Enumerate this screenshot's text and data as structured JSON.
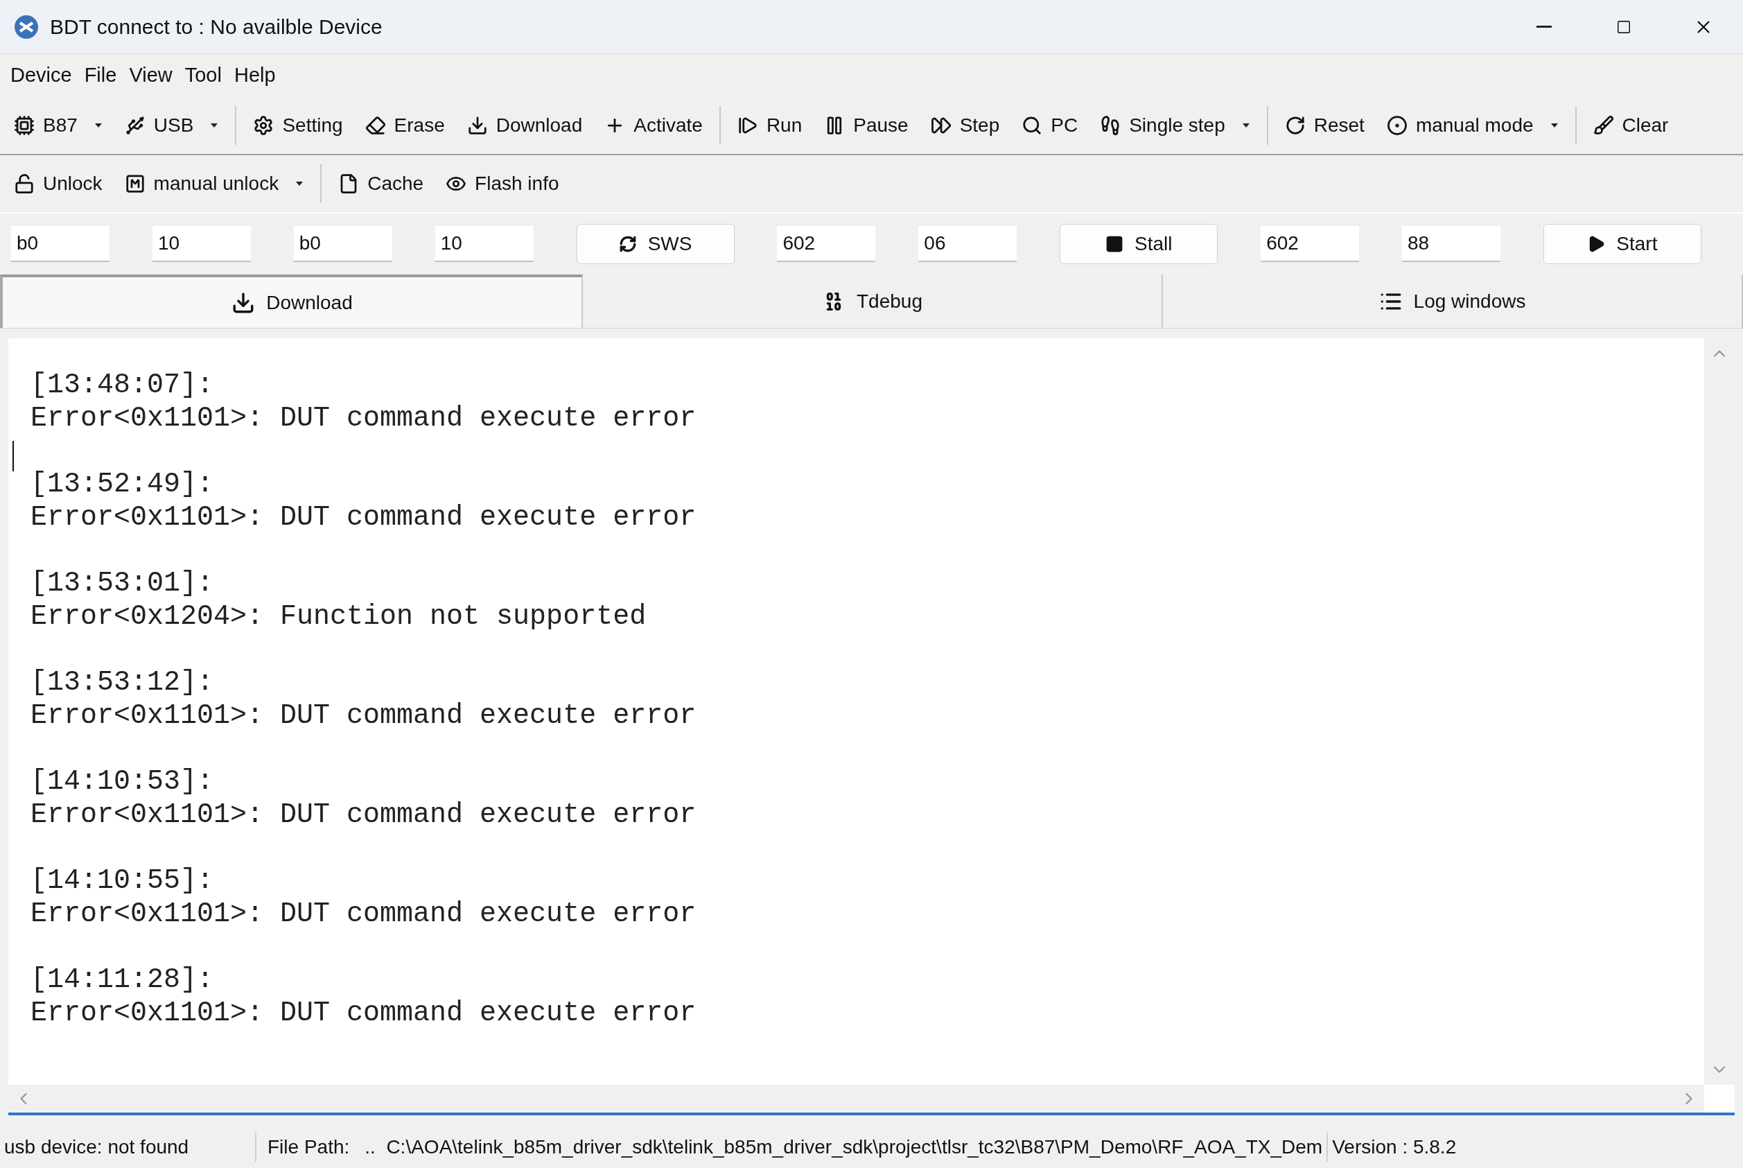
{
  "window": {
    "title": "BDT connect to : No availble Device"
  },
  "menu": [
    "Device",
    "File",
    "View",
    "Tool",
    "Help"
  ],
  "toolbar_1": [
    [
      {
        "label": "B87",
        "kind": "dropdown"
      },
      {
        "label": "USB",
        "kind": "dropdown"
      }
    ],
    [
      {
        "label": "Setting",
        "kind": "button"
      },
      {
        "label": "Erase",
        "kind": "button"
      },
      {
        "label": "Download",
        "kind": "button"
      },
      {
        "label": "Activate",
        "kind": "button"
      }
    ],
    [
      {
        "label": "Run",
        "kind": "button"
      },
      {
        "label": "Pause",
        "kind": "button"
      },
      {
        "label": "Step",
        "kind": "button"
      },
      {
        "label": "PC",
        "kind": "button"
      },
      {
        "label": "Single step",
        "kind": "dropdown"
      }
    ],
    [
      {
        "label": "Reset",
        "kind": "button"
      },
      {
        "label": "manual mode",
        "kind": "dropdown"
      }
    ],
    [
      {
        "label": "Clear",
        "kind": "button"
      }
    ]
  ],
  "toolbar_2": [
    [
      {
        "label": "Unlock",
        "kind": "button"
      },
      {
        "label": "manual unlock",
        "kind": "dropdown"
      }
    ],
    [
      {
        "label": "Cache",
        "kind": "button"
      },
      {
        "label": "Flash info",
        "kind": "button"
      }
    ]
  ],
  "command_row": [
    {
      "kind": "field",
      "value": "b0"
    },
    {
      "kind": "field",
      "value": "10"
    },
    {
      "kind": "field",
      "value": "b0"
    },
    {
      "kind": "field",
      "value": "10"
    },
    {
      "kind": "button",
      "label": "SWS"
    },
    {
      "kind": "field",
      "value": "602"
    },
    {
      "kind": "field",
      "value": "06"
    },
    {
      "kind": "button",
      "label": "Stall"
    },
    {
      "kind": "field",
      "value": "602"
    },
    {
      "kind": "field",
      "value": "88"
    },
    {
      "kind": "button",
      "label": "Start"
    }
  ],
  "tabs": [
    {
      "label": "Download",
      "selected": true
    },
    {
      "label": "Tdebug",
      "selected": false
    },
    {
      "label": "Log windows",
      "selected": false
    }
  ],
  "log": [
    {
      "time": "[13:48:07]:",
      "message": "Error<0x1101>: DUT command execute error"
    },
    {
      "time": "[13:52:49]:",
      "message": "Error<0x1101>: DUT command execute error"
    },
    {
      "time": "[13:53:01]:",
      "message": "Error<0x1204>: Function not supported"
    },
    {
      "time": "[13:53:12]:",
      "message": "Error<0x1101>: DUT command execute error"
    },
    {
      "time": "[14:10:53]:",
      "message": "Error<0x1101>: DUT command execute error"
    },
    {
      "time": "[14:10:55]:",
      "message": "Error<0x1101>: DUT command execute error"
    },
    {
      "time": "[14:11:28]:",
      "message": "Error<0x1101>: DUT command execute error"
    }
  ],
  "status_bar": {
    "device": "usb device: not found",
    "file_path_label": "File Path:",
    "file_path": "..  C:\\AOA\\telink_b85m_driver_sdk\\telink_b85m_driver_sdk\\project\\tlsr_tc32\\B87\\PM_Demo\\RF_AOA_TX_Dem",
    "version": "Version : 5.8.2"
  }
}
